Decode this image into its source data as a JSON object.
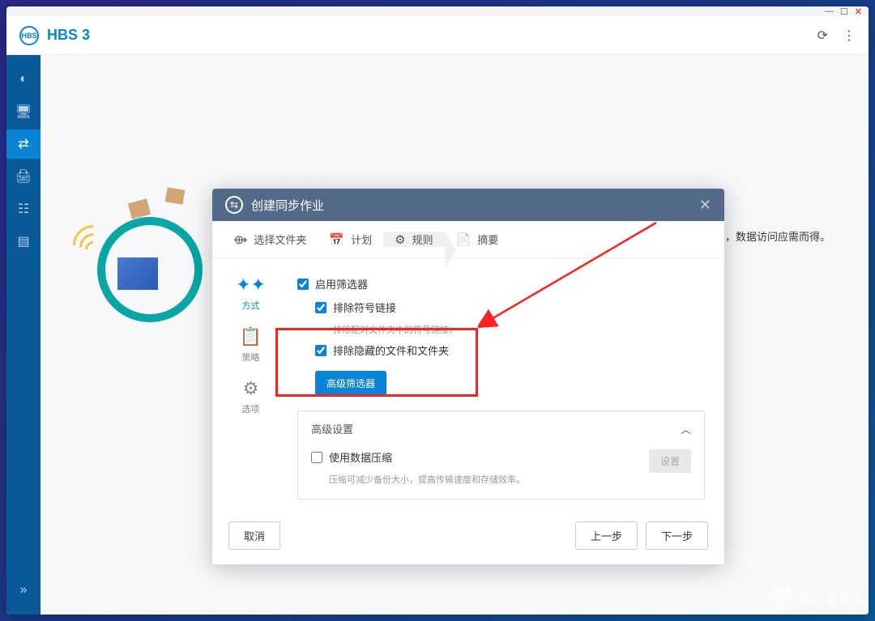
{
  "app": {
    "title": "HBS 3"
  },
  "bg_text": "，数据访问应需而得。",
  "modal": {
    "title": "创建同步作业",
    "steps": {
      "folder": "选择文件夹",
      "schedule": "计划",
      "rules": "规则",
      "summary": "摘要"
    },
    "tabs": {
      "method": "方式",
      "policy": "策略",
      "options": "选项"
    },
    "settings": {
      "enable_filter": "启用筛选器",
      "exclude_symlinks": "排除符号链接",
      "exclude_symlinks_desc": "排除配对文件夹中的符号链接。",
      "exclude_hidden": "排除隐藏的文件和文件夹",
      "adv_filter_btn": "高级筛选器",
      "adv_panel_title": "高级设置",
      "use_compression": "使用数据压缩",
      "compression_desc": "压缩可减少备份大小，提高传输速度和存储效率。",
      "config_btn": "设置"
    },
    "footer": {
      "cancel": "取消",
      "prev": "上一步",
      "next": "下一步"
    }
  },
  "watermark": "什么值得买"
}
